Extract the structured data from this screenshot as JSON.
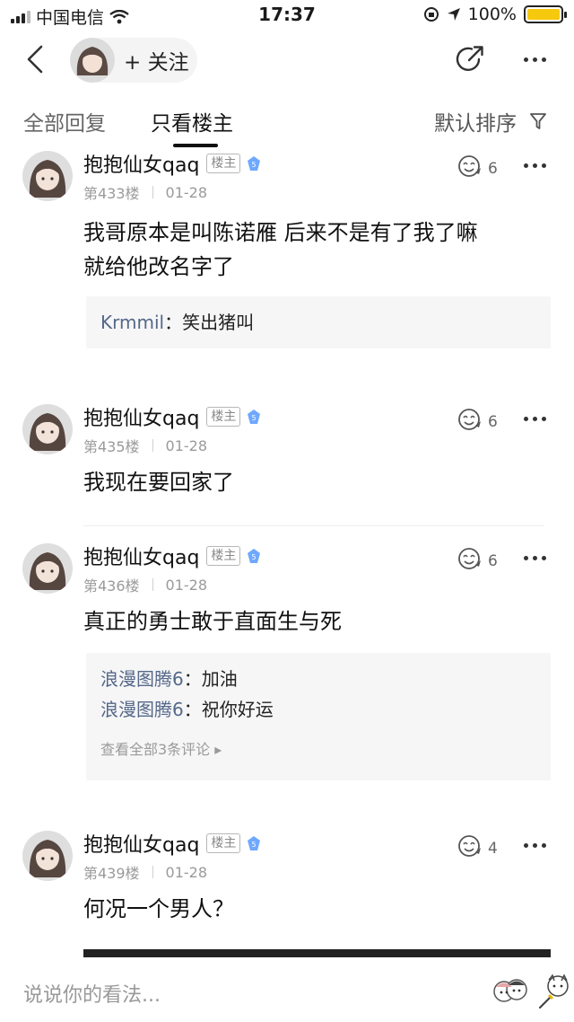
{
  "status_bar": {
    "carrier": "中国电信",
    "time": "17:37",
    "battery": "100%"
  },
  "nav": {
    "follow_label": "+ 关注"
  },
  "tabs": {
    "all": "全部回复",
    "op_only": "只看楼主",
    "sort": "默认排序"
  },
  "posts": [
    {
      "username": "抱抱仙女qaq",
      "badge": "楼主",
      "level": "5",
      "floor": "第433楼",
      "date": "01-28",
      "likes": "6",
      "text_lines": [
        "我哥原本是叫陈诺雁 后来不是有了我了嘛",
        "就给他改名字了"
      ],
      "replies": [
        {
          "user": "Krmmil",
          "text": "：笑出猪叫"
        }
      ]
    },
    {
      "username": "抱抱仙女qaq",
      "badge": "楼主",
      "level": "5",
      "floor": "第435楼",
      "date": "01-28",
      "likes": "6",
      "text_lines": [
        "我现在要回家了"
      ],
      "replies": []
    },
    {
      "username": "抱抱仙女qaq",
      "badge": "楼主",
      "level": "5",
      "floor": "第436楼",
      "date": "01-28",
      "likes": "6",
      "text_lines": [
        "真正的勇士敢于直面生与死"
      ],
      "replies": [
        {
          "user": "浪漫图腾6",
          "text": "：加油"
        },
        {
          "user": "浪漫图腾6",
          "text": "：祝你好运"
        }
      ],
      "more_replies": "查看全部3条评论 ▸"
    },
    {
      "username": "抱抱仙女qaq",
      "badge": "楼主",
      "level": "5",
      "floor": "第439楼",
      "date": "01-28",
      "likes": "4",
      "text_lines": [
        "何况一个男人？"
      ],
      "replies": []
    }
  ],
  "bottom": {
    "placeholder": "说说你的看法..."
  },
  "colors": {
    "battery": "#f6c90e",
    "level_badge": "#6fa8ff",
    "reply_user": "#55688a"
  }
}
